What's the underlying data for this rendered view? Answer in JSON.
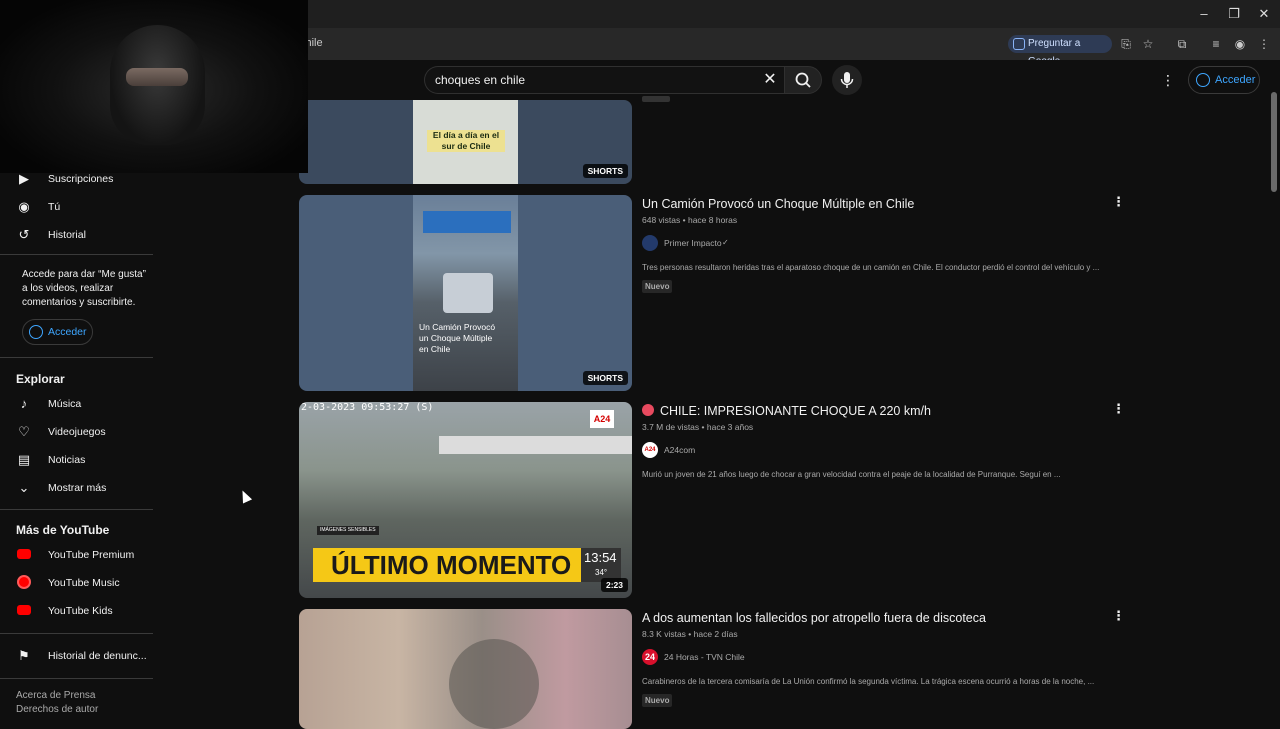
{
  "browser": {
    "url_text": "chile",
    "ask_google_label": "Preguntar a Google",
    "window_controls": [
      "minimize-icon",
      "restore-icon",
      "close-icon"
    ]
  },
  "header": {
    "search_query": "choques en chile",
    "signin_label": "Acceder"
  },
  "sidebar": {
    "items_top": [
      {
        "label": "Suscripciones",
        "icon": "subscriptions-icon"
      },
      {
        "label": "Tú",
        "icon": "user-icon"
      },
      {
        "label": "Historial",
        "icon": "history-icon"
      }
    ],
    "signin_message": "Accede para dar “Me gusta” a los videos, realizar comentarios y suscribirte.",
    "signin_label": "Acceder",
    "explore_heading": "Explorar",
    "explore_items": [
      {
        "label": "Música",
        "icon": "music-icon"
      },
      {
        "label": "Videojuegos",
        "icon": "gaming-icon"
      },
      {
        "label": "Noticias",
        "icon": "news-icon"
      },
      {
        "label": "Mostrar más",
        "icon": "chevron-down-icon"
      }
    ],
    "more_heading": "Más de YouTube",
    "more_items": [
      {
        "label": "YouTube Premium",
        "icon": "youtube-premium-icon"
      },
      {
        "label": "YouTube Music",
        "icon": "youtube-music-icon"
      },
      {
        "label": "YouTube Kids",
        "icon": "youtube-kids-icon"
      }
    ],
    "report_history": "Historial de denunc...",
    "footer": {
      "line1": "Acerca de  Prensa",
      "line2": "Derechos de autor"
    }
  },
  "results": [
    {
      "thumb_text": "El día a día en el sur de Chile",
      "badge": "SHORTS"
    },
    {
      "title": "Un Camión Provocó un Choque Múltiple en Chile",
      "meta": "648 vistas • hace 8 horas",
      "channel": "Primer Impacto",
      "verified": "✓",
      "description": "Tres personas resultaron heridas tras el aparatoso choque de un camión en Chile. El conductor perdió el control del vehículo y ...",
      "new_badge": "Nuevo",
      "thumb_text": "Un Camión Provocó un Choque Múltiple en Chile",
      "badge": "SHORTS"
    },
    {
      "title": "CHILE: IMPRESIONANTE CHOQUE A 220 km/h",
      "meta": "3.7 M de vistas • hace 3 años",
      "channel": "A24com",
      "channel_avatar_text": "A24",
      "description": "Murió un joven de 21 años luego de chocar a gran velocidad contra el peaje de la localidad de Purranque. Seguí en ...",
      "thumb_timestamp": "2-03-2023 09:53:27 (S)",
      "thumb_logo": "A24",
      "thumb_banner": "ÚLTIMO MOMENTO",
      "thumb_tag": "IMÁGENES SENSIBLES",
      "thumb_clock": "13:54",
      "thumb_temp": "34°",
      "badge": "2:23"
    },
    {
      "title": "A dos aumentan los fallecidos por atropello fuera de discoteca",
      "meta": "8.3 K vistas • hace 2 días",
      "channel": "24 Horas - TVN Chile",
      "channel_avatar_text": "24",
      "description": "Carabineros de la tercera comisaría de La Unión confirmó la segunda víctima. La trágica escena ocurrió a horas de la noche, ...",
      "new_badge": "Nuevo"
    }
  ],
  "colors": {
    "background": "#0f0f0f",
    "accent_link": "#3ea6ff",
    "youtube_red": "#ff0000"
  }
}
